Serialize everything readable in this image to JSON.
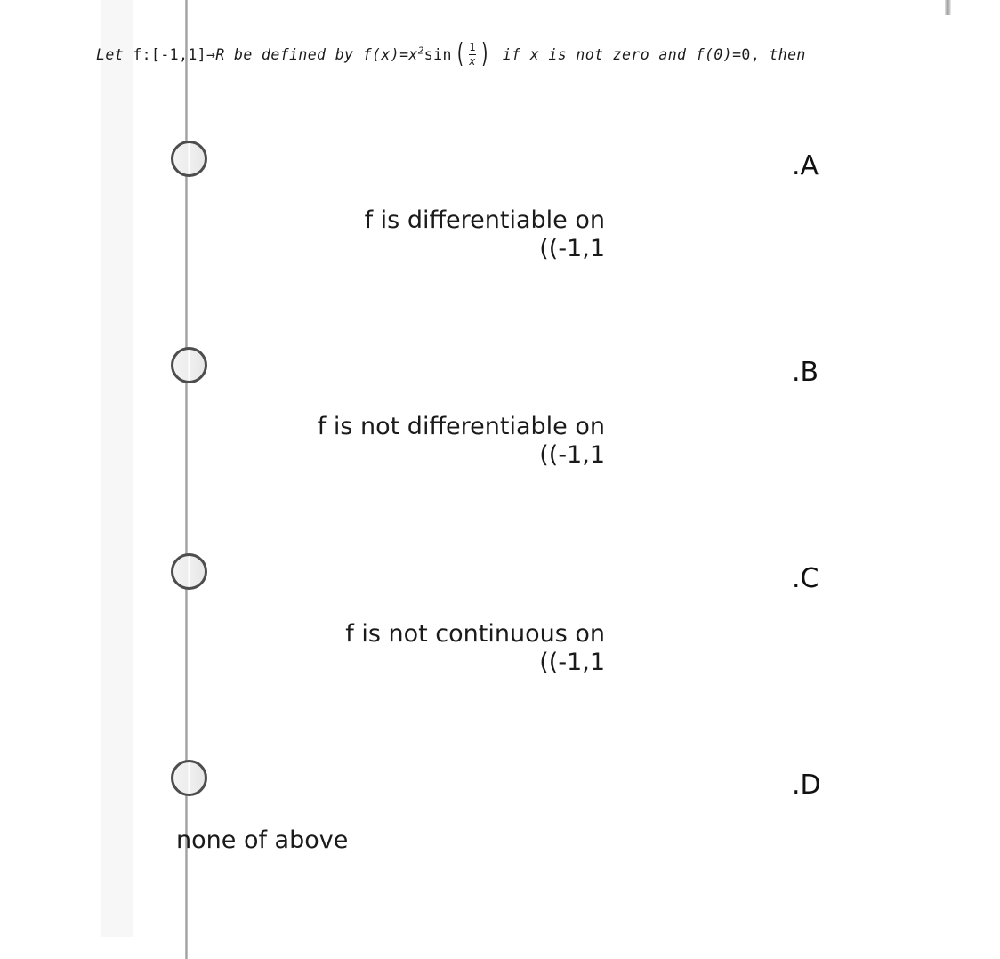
{
  "question": {
    "prefix": "Let ",
    "func_decl": "f:[-1,1]",
    "arrow": "→",
    "codomain": "R",
    "be_defined": " be defined by ",
    "fx": "f(x)",
    "equals": "=",
    "x_base": "x",
    "x_exp": "2",
    "sin": "sin",
    "frac_num": "1",
    "frac_den": "x",
    "condition": " if x is not zero and ",
    "f0": "f(0)",
    "f0_eq": "=0,",
    "then": " then",
    "full_text": "Let f:[-1,1]→R be defined by f(x)=x²sin(1/x) if x is not zero and f(0)=0, then"
  },
  "options": [
    {
      "letter": ".A",
      "text": "f is differentiable on\n((-1,1",
      "selected": false
    },
    {
      "letter": ".B",
      "text": "f is not differentiable on\n((-1,1",
      "selected": false
    },
    {
      "letter": ".C",
      "text": "f is not continuous on\n((-1,1",
      "selected": false
    },
    {
      "letter": ".D",
      "text": "none of above",
      "selected": false
    }
  ],
  "colors": {
    "page_background": "#ffffff",
    "stripe": "#f7f7f7",
    "rule": "#9a9a9a",
    "radio_border": "#4d4d4d",
    "text": "#111111"
  }
}
